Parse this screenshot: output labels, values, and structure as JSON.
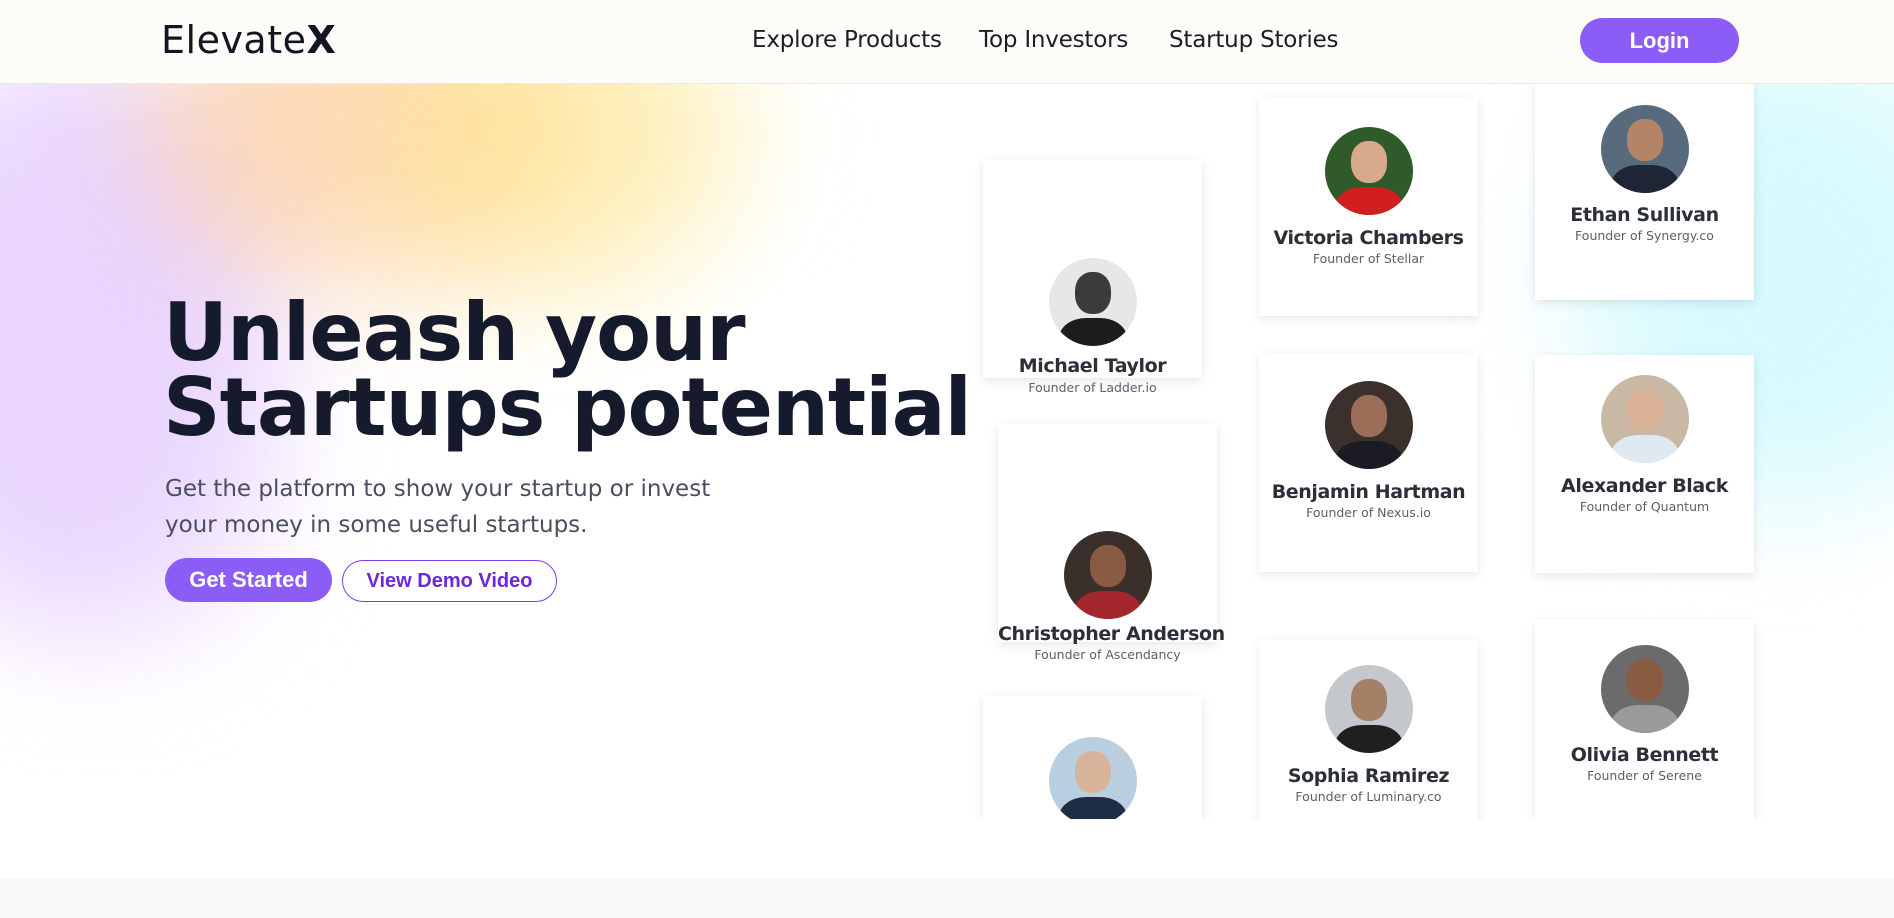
{
  "brand": {
    "name": "Elevate",
    "mark": "X"
  },
  "nav": {
    "links": [
      "Explore Products",
      "Top Investors",
      "Startup Stories"
    ],
    "login_label": "Login"
  },
  "hero": {
    "title_line1": "Unleash your",
    "title_line2": "Startups potential",
    "subtitle_line1": "Get the platform to show your startup or invest",
    "subtitle_line2": "your money in some useful startups.",
    "primary_label": "Get Started",
    "secondary_label": "View Demo Video"
  },
  "founders": [
    {
      "name": "Michael Taylor",
      "role": "Founder of Ladder.io"
    },
    {
      "name": "Victoria Chambers",
      "role": "Founder of Stellar"
    },
    {
      "name": "Ethan Sullivan",
      "role": "Founder of Synergy.co"
    },
    {
      "name": "Christopher Anderson",
      "role": "Founder of Ascendancy"
    },
    {
      "name": "Benjamin Hartman",
      "role": "Founder of Nexus.io"
    },
    {
      "name": "Alexander Black",
      "role": "Founder of Quantum"
    },
    {
      "name": "",
      "role": ""
    },
    {
      "name": "Sophia Ramirez",
      "role": "Founder of Luminary.co"
    },
    {
      "name": "Olivia Bennett",
      "role": "Founder of Serene"
    }
  ],
  "colors": {
    "accent": "#8b5cf6",
    "accent_dark": "#6d28d9",
    "heading": "#151a2d"
  }
}
